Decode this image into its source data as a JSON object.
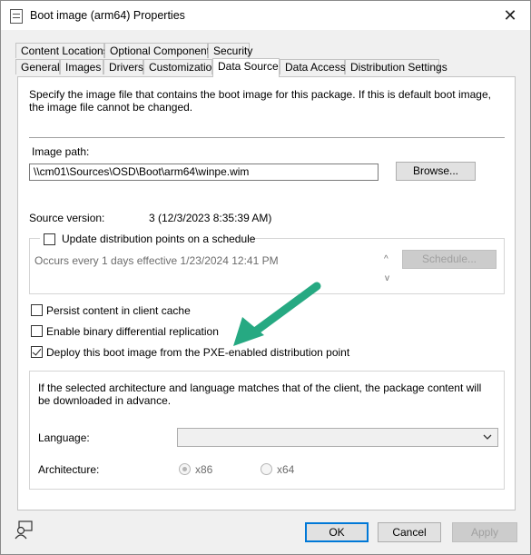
{
  "window": {
    "title": "Boot image (arm64) Properties",
    "close_glyph": "✕"
  },
  "tabs": {
    "row1": [
      "Content Locations",
      "Optional Components",
      "Security"
    ],
    "row2": [
      "General",
      "Images",
      "Drivers",
      "Customization",
      "Data Source",
      "Data Access",
      "Distribution Settings"
    ],
    "active": "Data Source"
  },
  "panel": {
    "description": "Specify the image file that contains the boot image for this package. If this is default boot image, the image file cannot be changed.",
    "image_path_label": "Image path:",
    "image_path_value": "\\\\cm01\\Sources\\OSD\\Boot\\arm64\\winpe.wim",
    "browse_label": "Browse...",
    "source_version_label": "Source version:",
    "source_version_value": "3 (12/3/2023 8:35:39 AM)",
    "schedule_group": {
      "checkbox_label": "Update distribution points on a schedule",
      "checked": false,
      "schedule_text": "Occurs every 1 days effective 1/23/2024 12:41 PM",
      "schedule_button": "Schedule...",
      "scroll_up": "^",
      "scroll_down": "v"
    },
    "persist_label": "Persist content in client cache",
    "persist_checked": false,
    "binary_label": "Enable binary differential replication",
    "binary_checked": false,
    "pxe_label": "Deploy this boot image from the PXE-enabled distribution point",
    "pxe_checked": true,
    "pxe_group": {
      "info": "If the selected architecture and language matches that of the client, the package content will be downloaded in advance.",
      "language_label": "Language:",
      "language_value": "",
      "architecture_label": "Architecture:",
      "arch_x86": "x86",
      "arch_x64": "x64",
      "arch_selected": "x86"
    }
  },
  "annotation": {
    "arrow_color": "#26a982"
  },
  "footer": {
    "ok": "OK",
    "cancel": "Cancel",
    "apply": "Apply"
  }
}
